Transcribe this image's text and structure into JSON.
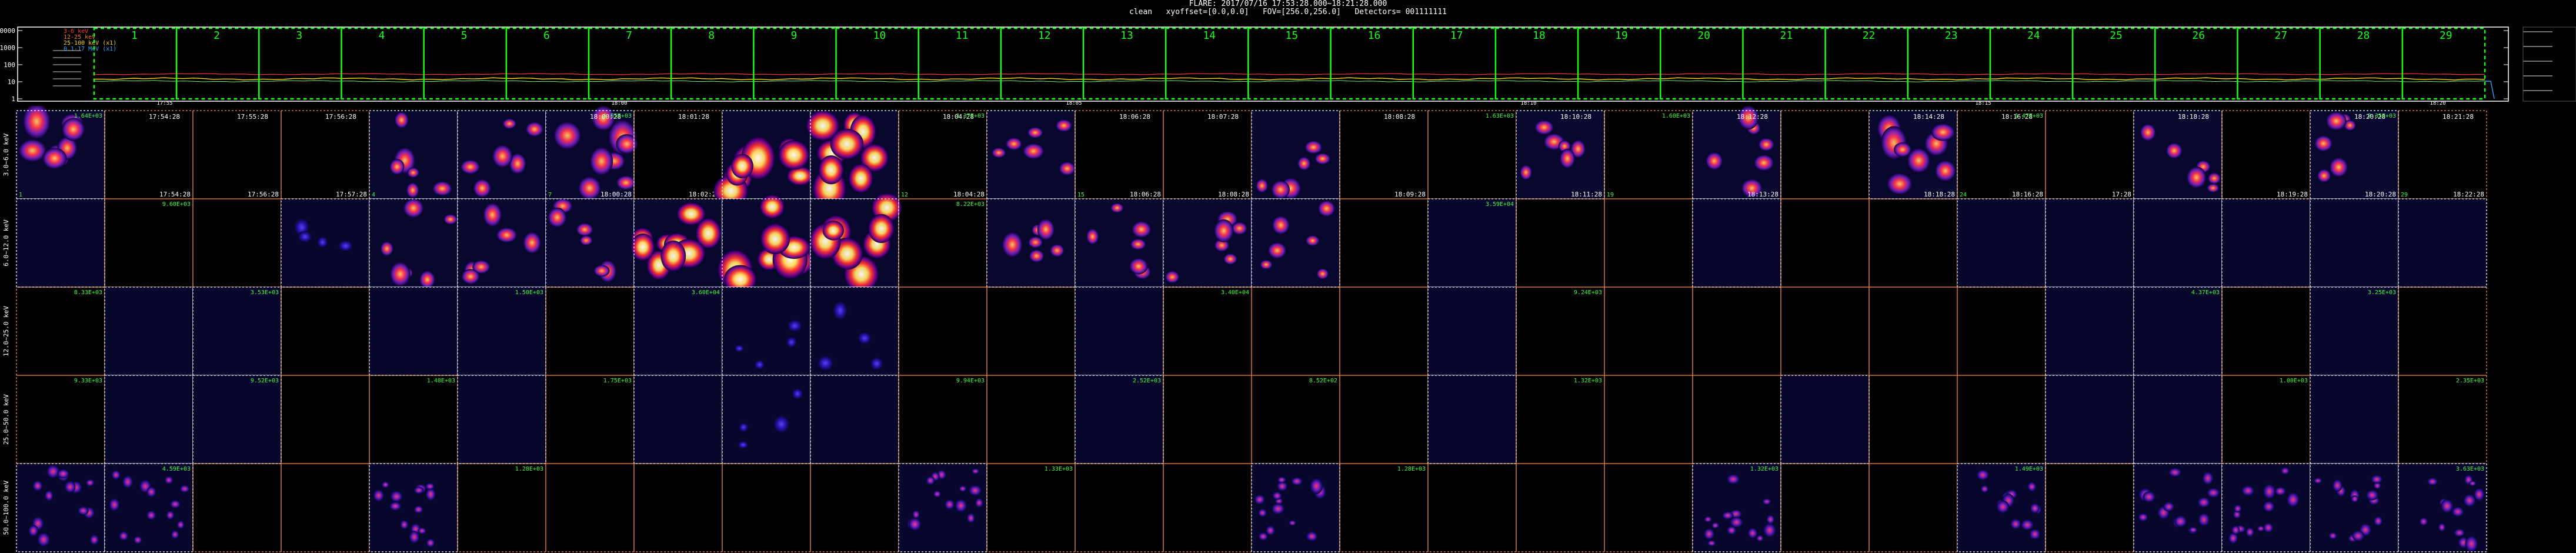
{
  "header": {
    "line1": "FLARE: 2017/07/16 17:53:28.000~18:21:28.000",
    "line2": "clean   xyoffset=[0.0,0.0]   FOV=[256.0,256.0]   Detectors= 001111111"
  },
  "lightcurve": {
    "y_ticks": [
      "10000",
      "1000",
      "100",
      "10",
      "1"
    ],
    "legend": [
      {
        "label": "3-6 keV",
        "color": "#ff3b3b"
      },
      {
        "label": "12-25 keV",
        "color": "#ff7a2a"
      },
      {
        "label": "25-100 keV (x1)",
        "color": "#ffd400"
      },
      {
        "label": "0.1-17 MeV (x1)",
        "color": "#2aa7ff"
      }
    ],
    "time_ticks": [
      "17:55",
      "18:00",
      "18:05",
      "18:10",
      "18:15",
      "18:20"
    ],
    "window_labels": [
      "1",
      "2",
      "3",
      "4",
      "5",
      "6",
      "7",
      "8",
      "9",
      "10",
      "11",
      "12",
      "13",
      "14",
      "15",
      "16",
      "17",
      "18",
      "19",
      "20",
      "21",
      "22",
      "23",
      "24",
      "25",
      "26",
      "27",
      "28",
      "29"
    ],
    "left_tick_text": "1000",
    "colors": {
      "box": "#14ff14",
      "curve_red": "#ff3232",
      "curve_yellow": "#ffd400",
      "curve_blue": "#2aa7ff"
    }
  },
  "rows": [
    {
      "label": "3.0~6.0 keV"
    },
    {
      "label": "6.0~12.0 keV"
    },
    {
      "label": "12.0~25.0 keV"
    },
    {
      "label": "25.0~50.0 keV"
    },
    {
      "label": "50.0~100.0 keV"
    }
  ],
  "row0": {
    "tl": [
      "",
      "17:54:28",
      "17:55:28",
      "17:56:28",
      "",
      "",
      "18:00:28",
      "18:01:28",
      "",
      "",
      "18:04:28",
      "",
      "18:06:28",
      "18:07:28",
      "",
      "18:08:28",
      "",
      "18:10:28",
      "",
      "18:12:28",
      "",
      "18:14:28",
      "18:16:28",
      "",
      "18:18:28",
      "",
      "18:20:28",
      "18:21:28"
    ],
    "tr": [
      "1.64E+03",
      "",
      "",
      "",
      "",
      "",
      "1.55E+03",
      "",
      "",
      "",
      "1.37E+03",
      "",
      "",
      "",
      "",
      "",
      "1.63E+03",
      "",
      "1.60E+03",
      "",
      "",
      "",
      "1.47E+03",
      "",
      "",
      "",
      "2.35E+03",
      ""
    ],
    "bl": [
      "1",
      "",
      "",
      "",
      "4",
      "",
      "7",
      "",
      "",
      "",
      "12",
      "",
      "15",
      "",
      "",
      "",
      "",
      "",
      "19",
      "",
      "",
      "",
      "24",
      "",
      "",
      "",
      "",
      "29"
    ],
    "br": [
      "",
      "17:54:28",
      "17:56:28",
      "17:57:28",
      "",
      "",
      "18:00:28",
      "18:02:28",
      "",
      "",
      "18:04:28",
      "",
      "18:06:28",
      "18:08:28",
      "",
      "18:09:28",
      "",
      "18:11:28",
      "",
      "18:13:28",
      "",
      "18:18:28",
      "18:16:28",
      "17:28",
      "",
      "18:19:28",
      "18:20:28",
      "18:22:28"
    ]
  },
  "badges": {
    "row1": [
      "",
      "9.60E+03",
      "",
      "",
      "",
      "",
      "",
      "",
      "",
      "",
      "8.22E+03",
      "",
      "",
      "",
      "",
      "",
      "3.59E+04",
      "",
      "",
      "",
      "",
      "",
      "",
      "",
      "",
      "",
      "",
      ""
    ],
    "row2": [
      "8.33E+03",
      "",
      "3.53E+03",
      "",
      "",
      "1.50E+03",
      "",
      "3.60E+04",
      "",
      "",
      "",
      "",
      "",
      "3.40E+04",
      "",
      "",
      "",
      "9.24E+03",
      "",
      "",
      "",
      "",
      "",
      "",
      "4.37E+03",
      "",
      "3.25E+03",
      ""
    ],
    "row3": [
      "9.33E+03",
      "",
      "9.52E+03",
      "",
      "1.48E+03",
      "",
      "1.75E+03",
      "",
      "",
      "",
      "9.94E+03",
      "",
      "2.52E+03",
      "",
      "8.52E+02",
      "",
      "",
      "1.32E+03",
      "",
      "",
      "",
      "",
      "",
      "",
      "",
      "1.00E+03",
      "",
      "2.35E+03"
    ],
    "row4": [
      "",
      "4.59E+03",
      "",
      "",
      "",
      "1.28E+03",
      "",
      "",
      "",
      "",
      "",
      "1.33E+03",
      "",
      "",
      "",
      "1.28E+03",
      "",
      "",
      "",
      "1.32E+03",
      "",
      "",
      "1.49E+03",
      "",
      "",
      "",
      "",
      "3.63E+03"
    ]
  },
  "images": {
    "row0": [
      "bright",
      "",
      "",
      "",
      "medium",
      "medium",
      "bright",
      "",
      "hot",
      "hot",
      "",
      "medium",
      "",
      "",
      "medium",
      "",
      "",
      "medium",
      "",
      "medium",
      "",
      "bright",
      "",
      "",
      "medium",
      "",
      "medium",
      ""
    ],
    "row1": [
      "navy",
      "",
      "",
      "faint",
      "medium",
      "medium",
      "medium",
      "hot",
      "hot",
      "hot",
      "",
      "medium",
      "medium",
      "medium",
      "medium",
      "",
      "navy",
      "",
      "",
      "navy",
      "",
      "",
      "navy",
      "navy",
      "navy",
      "navy",
      "navy",
      "navy"
    ],
    "row2": [
      "",
      "navy",
      "navy",
      "",
      "navy",
      "navy",
      "",
      "navy",
      "faint",
      "faint",
      "",
      "",
      "navy",
      "",
      "",
      "",
      "navy",
      "",
      "",
      "",
      "",
      "",
      "",
      "navy",
      "navy",
      "",
      "navy",
      ""
    ],
    "row3": [
      "",
      "navy",
      "navy",
      "",
      "",
      "navy",
      "",
      "navy",
      "faint",
      "navy",
      "",
      "",
      "navy",
      "",
      "",
      "",
      "navy",
      "",
      "",
      "",
      "navy",
      "",
      "",
      "navy",
      "navy",
      "",
      "navy",
      ""
    ],
    "row4": [
      "noise",
      "noise",
      "",
      "",
      "noise",
      "",
      "",
      "",
      "",
      "",
      "noise",
      "",
      "",
      "",
      "noise",
      "",
      "",
      "",
      "",
      "noise",
      "",
      "",
      "noise",
      "",
      "noise",
      "noise",
      "noise",
      "noise"
    ]
  }
}
